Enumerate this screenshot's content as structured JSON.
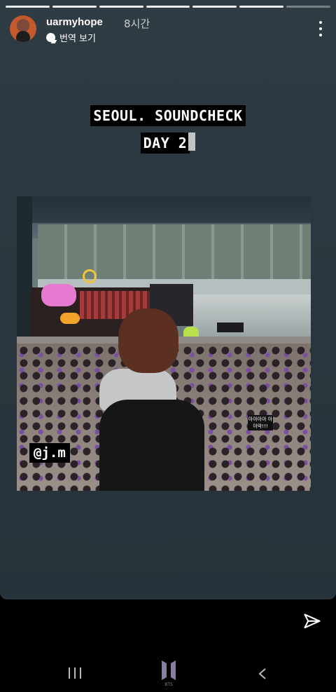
{
  "story": {
    "progress_segments": 7,
    "progress_active": 6,
    "username": "uarmyhope",
    "time_ago": "8시간",
    "translate_label": "번역 보기"
  },
  "caption": {
    "line1": "SEOUL. SOUNDCHECK",
    "line2": "DAY 2"
  },
  "photo": {
    "mention": "@j.m",
    "sign_text": "아아아아 아아악!!!"
  },
  "icons": {
    "more": "more-vertical-icon",
    "send": "send-icon",
    "nav_recent": "recent-apps-icon",
    "nav_home": "bts-logo-home-icon",
    "nav_back": "back-icon"
  },
  "colors": {
    "story_bg": "#2f3c44",
    "caption_bg": "#000000",
    "nav_bg": "#000000"
  }
}
